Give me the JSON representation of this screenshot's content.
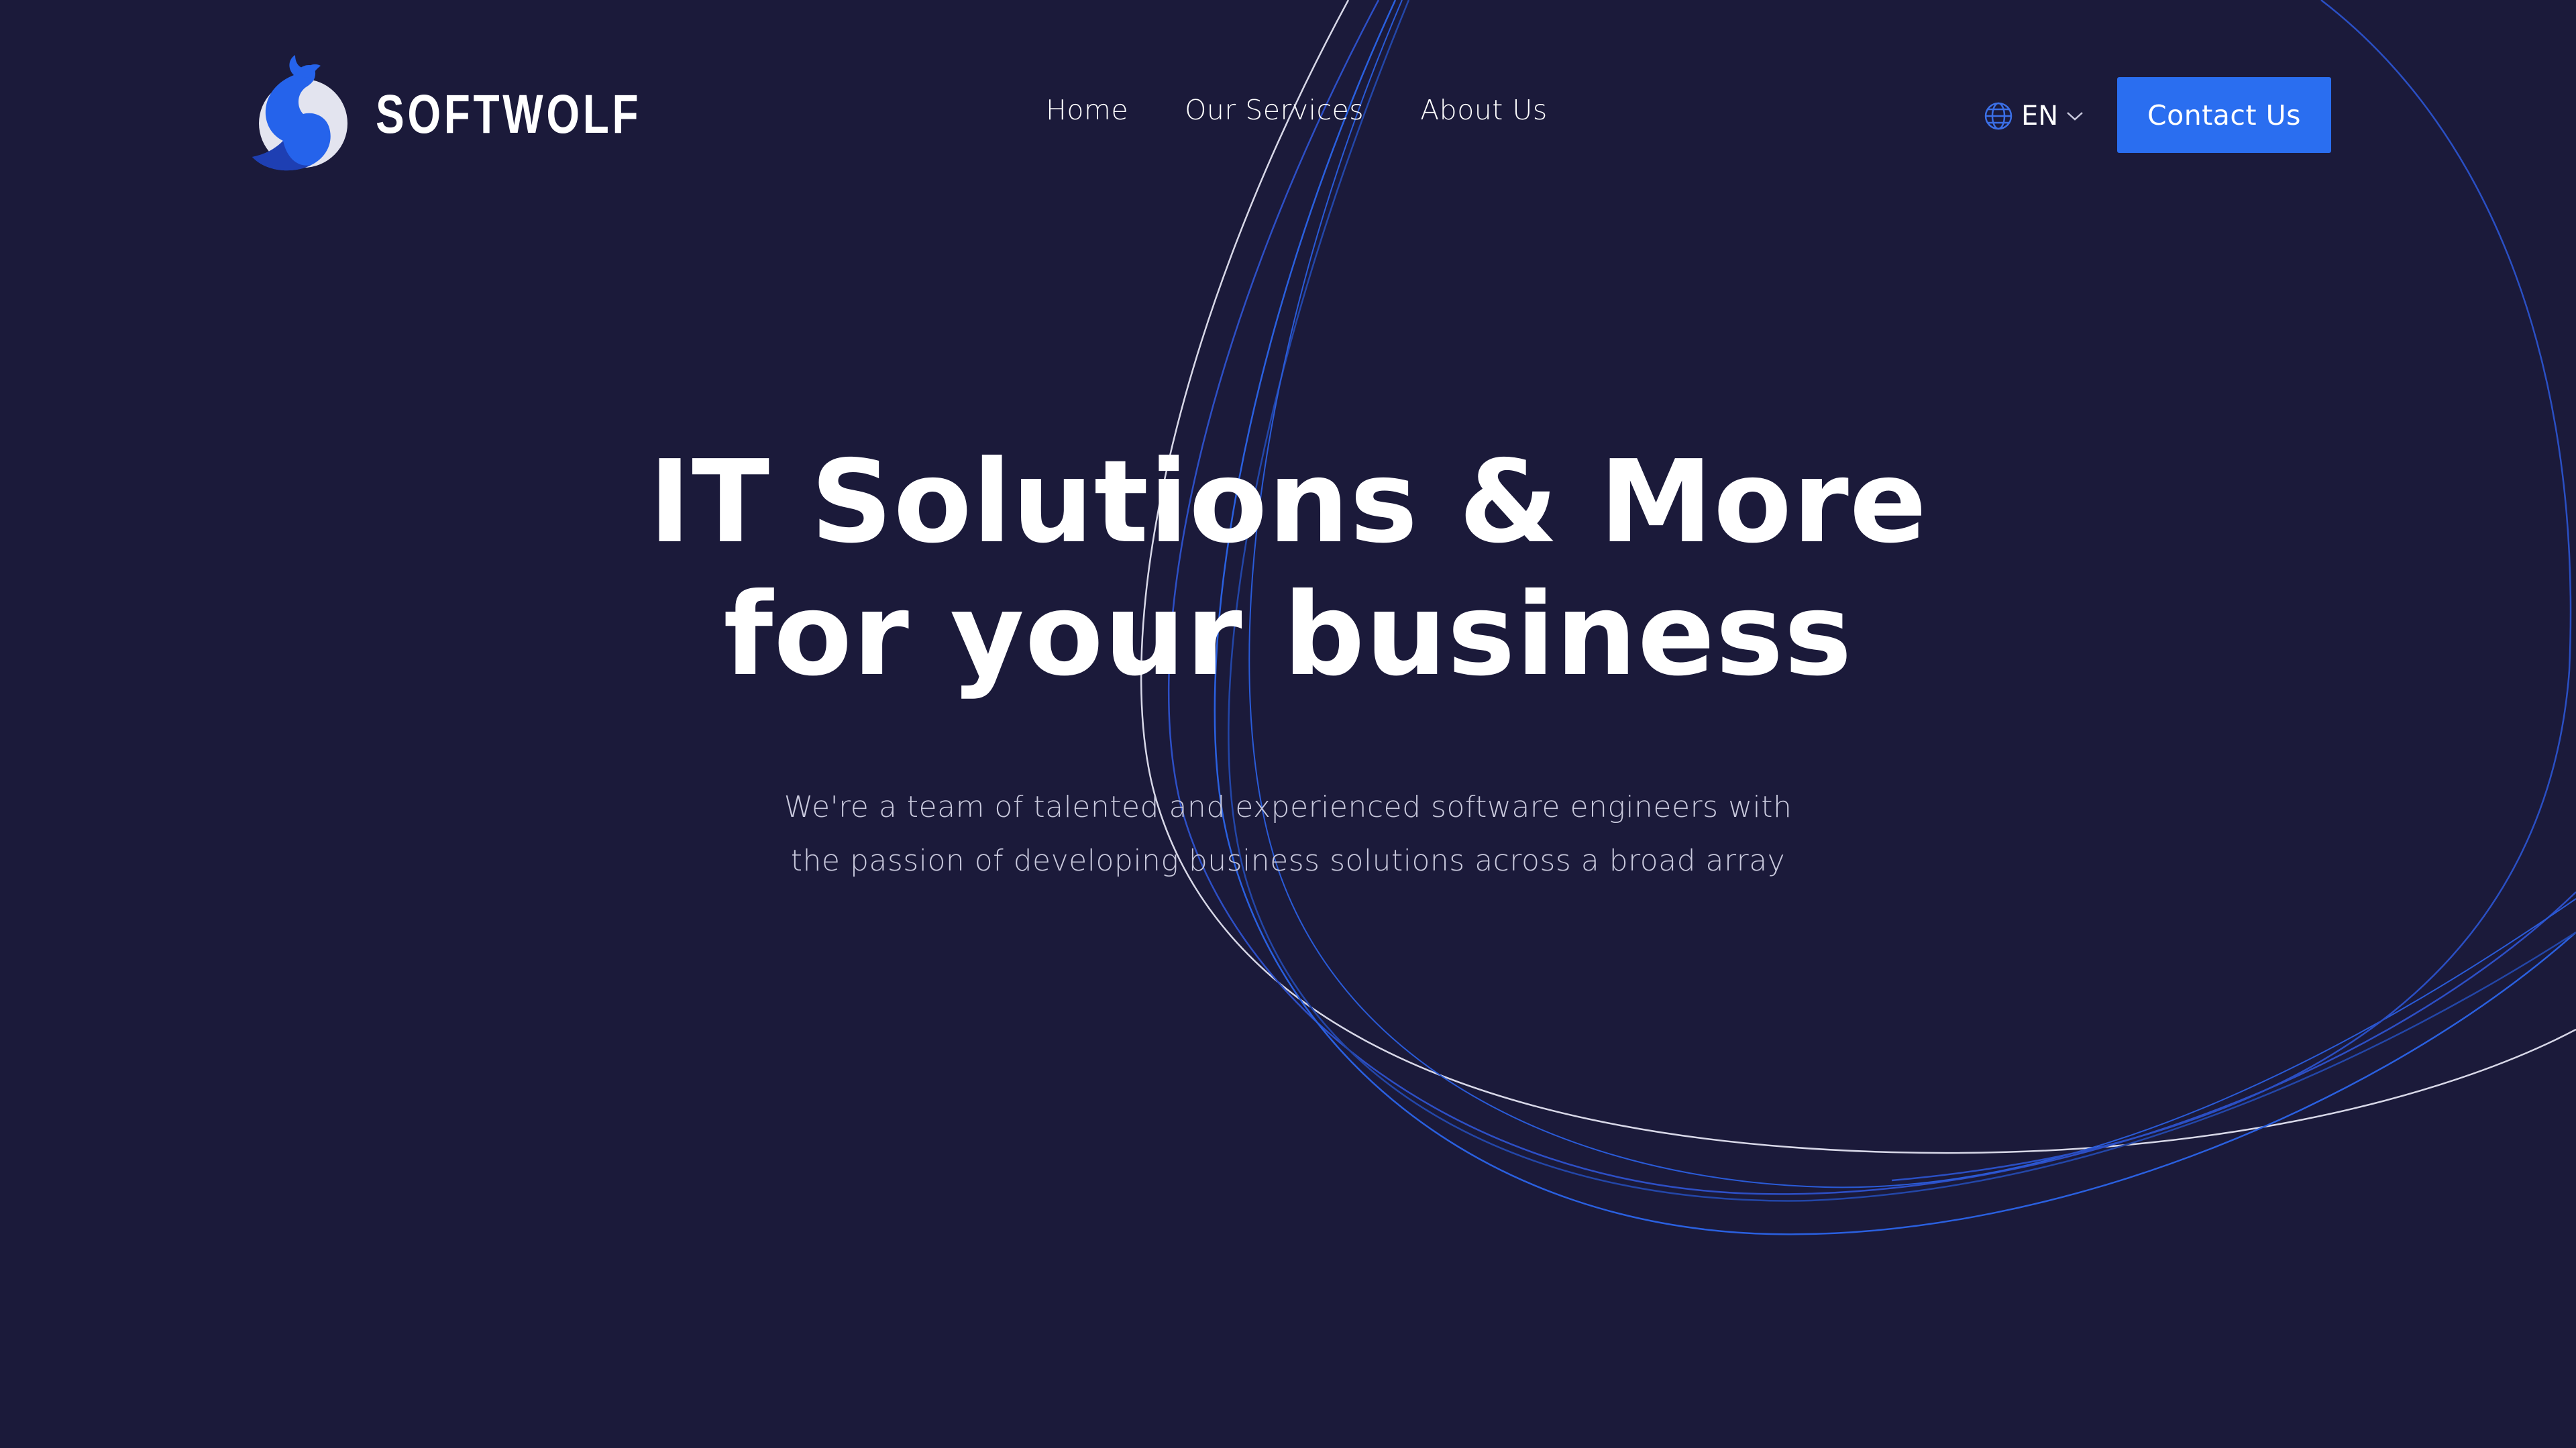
{
  "brand": {
    "name": "SOFTWOLF",
    "colors": {
      "background": "#1b1a3a",
      "accent": "#2a6ef0",
      "logo_blue": "#2563eb",
      "logo_light": "#e5e7f0"
    }
  },
  "nav": {
    "items": [
      {
        "label": "Home"
      },
      {
        "label": "Our Services"
      },
      {
        "label": "About Us"
      }
    ]
  },
  "language": {
    "icon": "globe-icon",
    "selected": "EN",
    "chevron": "chevron-down-icon"
  },
  "header": {
    "contact_label": "Contact Us"
  },
  "hero": {
    "title_line1": "IT Solutions & More",
    "title_line2": "for your business",
    "desc_line1": "We're a team of talented and experienced software engineers with",
    "desc_line2": "the passion of developing business solutions across a broad array"
  }
}
